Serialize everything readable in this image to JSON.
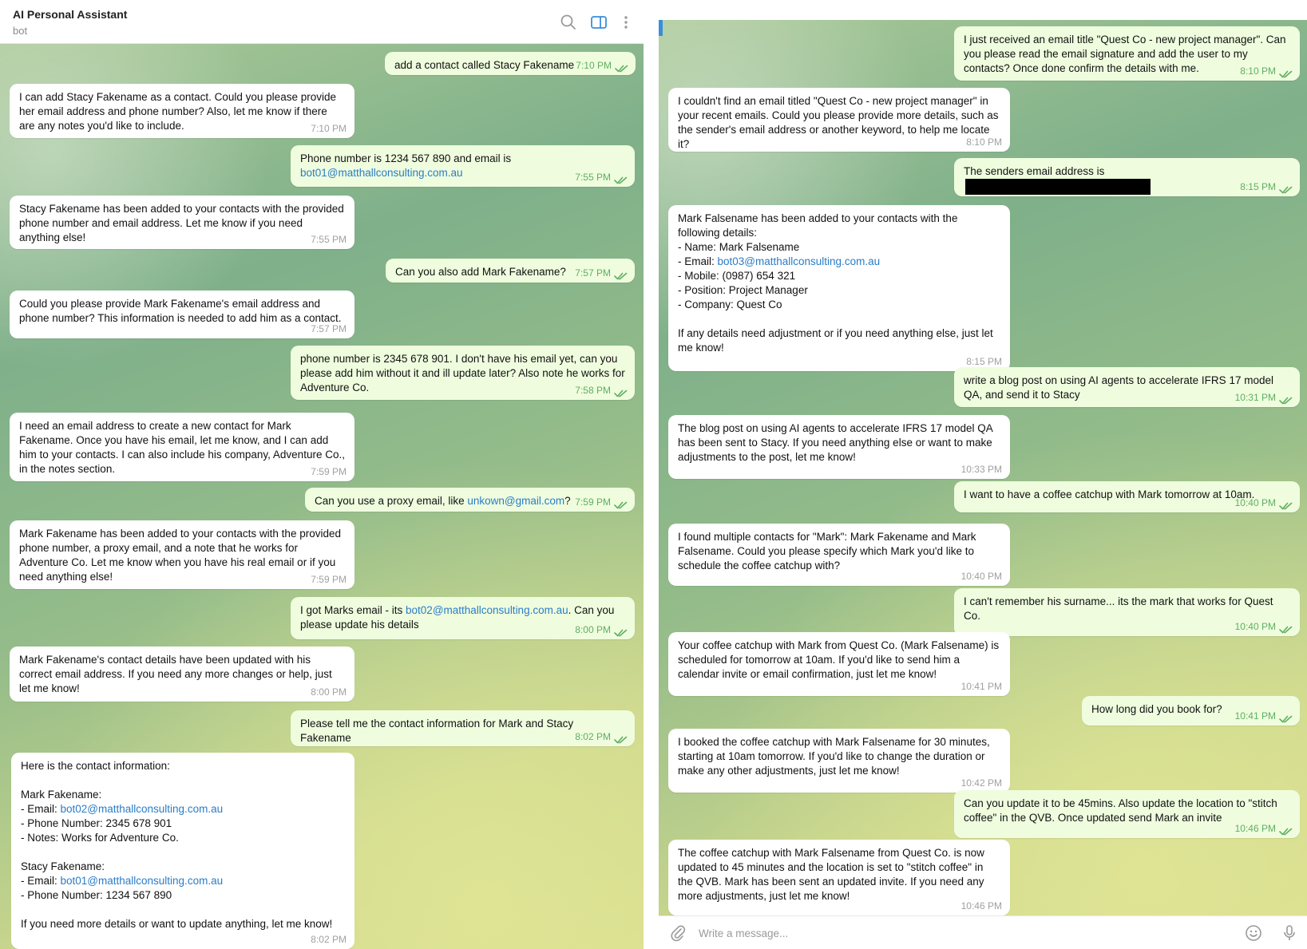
{
  "header": {
    "title": "AI Personal Assistant",
    "subtitle": "bot"
  },
  "left_messages": [
    {
      "dir": "out",
      "text": "add a contact called Stacy Fakename",
      "time": "7:10 PM"
    },
    {
      "dir": "in",
      "text": "I can add Stacy Fakename as a contact. Could you please provide her email address and phone number? Also, let me know if there are any notes you'd like to include.",
      "time": "7:10 PM"
    },
    {
      "dir": "out",
      "text_pre": "Phone number is 1234 567 890 and email is\n",
      "link": "bot01@matthallconsulting.com.au",
      "text_post": "",
      "time": "7:55 PM"
    },
    {
      "dir": "in",
      "text": "Stacy Fakename has been added to your contacts with the provided phone number and email address. Let me know if you need anything else!",
      "time": "7:55 PM"
    },
    {
      "dir": "out",
      "text": "Can you also add Mark Fakename?",
      "time": "7:57 PM"
    },
    {
      "dir": "in",
      "text": "Could you please provide Mark Fakename's email address and phone number? This information is needed to add him as a contact.",
      "time": "7:57 PM"
    },
    {
      "dir": "out",
      "text": "phone number is 2345 678 901. I don't have his email yet, can you please add him without it and ill update later? Also note he works for Adventure Co.",
      "time": "7:58 PM"
    },
    {
      "dir": "in",
      "text": "I need an email address to create a new contact for Mark Fakename. Once you have his email, let me know, and I can add him to your contacts. I can also include his company, Adventure Co., in the notes section.",
      "time": "7:59 PM"
    },
    {
      "dir": "out",
      "text_pre": "Can you use a proxy email, like ",
      "link": "unkown@gmail.com",
      "text_post": "?",
      "time": "7:59 PM"
    },
    {
      "dir": "in",
      "text": "Mark Fakename has been added to your contacts with the provided phone number, a proxy email, and a note that he works for Adventure Co. Let me know when you have his real email or if you need anything else!",
      "time": "7:59 PM"
    },
    {
      "dir": "out",
      "text_pre": "I got Marks email - its ",
      "link": "bot02@matthallconsulting.com.au",
      "text_post": ". Can you please update his details",
      "time": "8:00 PM"
    },
    {
      "dir": "in",
      "text": "Mark Fakename's contact details have been updated with his correct email address. If you need any more changes or help, just let me know!",
      "time": "8:00 PM"
    },
    {
      "dir": "out",
      "text": "Please tell me the contact information for Mark and Stacy Fakename",
      "time": "8:02 PM"
    },
    {
      "dir": "in",
      "lines": [
        {
          "t": "Here is the contact information:"
        },
        {
          "t": ""
        },
        {
          "t": "Mark Fakename:"
        },
        {
          "t": "- Email: ",
          "l": "bot02@matthallconsulting.com.au"
        },
        {
          "t": "- Phone Number: 2345 678 901"
        },
        {
          "t": "- Notes: Works for Adventure Co."
        },
        {
          "t": ""
        },
        {
          "t": "Stacy Fakename:"
        },
        {
          "t": "- Email: ",
          "l": "bot01@matthallconsulting.com.au"
        },
        {
          "t": "- Phone Number: 1234 567 890"
        },
        {
          "t": ""
        },
        {
          "t": "If you need more details or want to update anything, let me know!"
        }
      ],
      "time": "8:02 PM"
    }
  ],
  "right_messages": [
    {
      "dir": "out",
      "text": "I just received an email title \"Quest Co - new project manager\". Can you please read the email signature and add the user to my contacts? Once done confirm the details with me.",
      "time": "8:10 PM"
    },
    {
      "dir": "in",
      "text": "I couldn't find an email titled \"Quest Co - new project manager\" in your recent emails. Could you please provide more details, such as the sender's email address or another keyword, to help me locate it?",
      "time": "8:10 PM"
    },
    {
      "dir": "out",
      "text": "The senders email address is",
      "redacted": true,
      "time": "8:15 PM"
    },
    {
      "dir": "in",
      "lines": [
        {
          "t": "Mark Falsename has been added to your contacts with the following details:"
        },
        {
          "t": "- Name: Mark Falsename"
        },
        {
          "t": "- Email: ",
          "l": "bot03@matthallconsulting.com.au"
        },
        {
          "t": "- Mobile: (0987) 654 321"
        },
        {
          "t": "- Position: Project Manager"
        },
        {
          "t": "- Company: Quest Co"
        },
        {
          "t": ""
        },
        {
          "t": "If any details need adjustment or if you need anything else, just let me know!"
        }
      ],
      "time": "8:15 PM"
    },
    {
      "dir": "out",
      "text": "write a blog post on using AI agents to accelerate IFRS 17 model QA, and send it to Stacy",
      "time": "10:31 PM"
    },
    {
      "dir": "in",
      "text": "The blog post on using AI agents to accelerate IFRS 17 model QA has been sent to Stacy. If you need anything else or want to make adjustments to the post, let me know!",
      "time": "10:33 PM"
    },
    {
      "dir": "out",
      "text": "I want to have a coffee catchup with Mark tomorrow at 10am.",
      "time": "10:40 PM"
    },
    {
      "dir": "in",
      "text": "I found multiple contacts for \"Mark\": Mark Fakename and Mark Falsename. Could you please specify which Mark you'd like to schedule the coffee catchup with?",
      "time": "10:40 PM"
    },
    {
      "dir": "out",
      "text": "I can't remember his surname... its the mark that works for Quest Co.",
      "time": "10:40 PM"
    },
    {
      "dir": "in",
      "text": "Your coffee catchup with Mark from Quest Co. (Mark Falsename) is scheduled for tomorrow at 10am. If you'd like to send him a calendar invite or email confirmation, just let me know!",
      "time": "10:41 PM"
    },
    {
      "dir": "out",
      "text": "How long did you book for?",
      "time": "10:41 PM"
    },
    {
      "dir": "in",
      "text": "I booked the coffee catchup with Mark Falsename for 30 minutes, starting at 10am tomorrow. If you'd like to change the duration or make any other adjustments, just let me know!",
      "time": "10:42 PM"
    },
    {
      "dir": "out",
      "text": "Can you update it to be 45mins. Also update the location to \"stitch coffee\" in the QVB. Once updated send Mark an invite",
      "time": "10:46 PM"
    },
    {
      "dir": "in",
      "text": "The coffee catchup with Mark Falsename from Quest Co. is now updated to 45 minutes and the location is set to \"stitch coffee\" in the QVB. Mark has been sent an updated invite. If you need any more adjustments, just let me know!",
      "time": "10:46 PM"
    }
  ],
  "input": {
    "placeholder": "Write a message..."
  },
  "icons": {
    "search": "search-icon",
    "sidebar": "sidebar-toggle-icon",
    "more": "more-vertical-icon",
    "attach": "paperclip-icon",
    "emoji": "emoji-icon",
    "mic": "microphone-icon"
  },
  "colors": {
    "outgoing_bubble": "#effdde",
    "incoming_bubble": "#ffffff",
    "link": "#2a7cc7",
    "accent": "#3a8fd8"
  }
}
